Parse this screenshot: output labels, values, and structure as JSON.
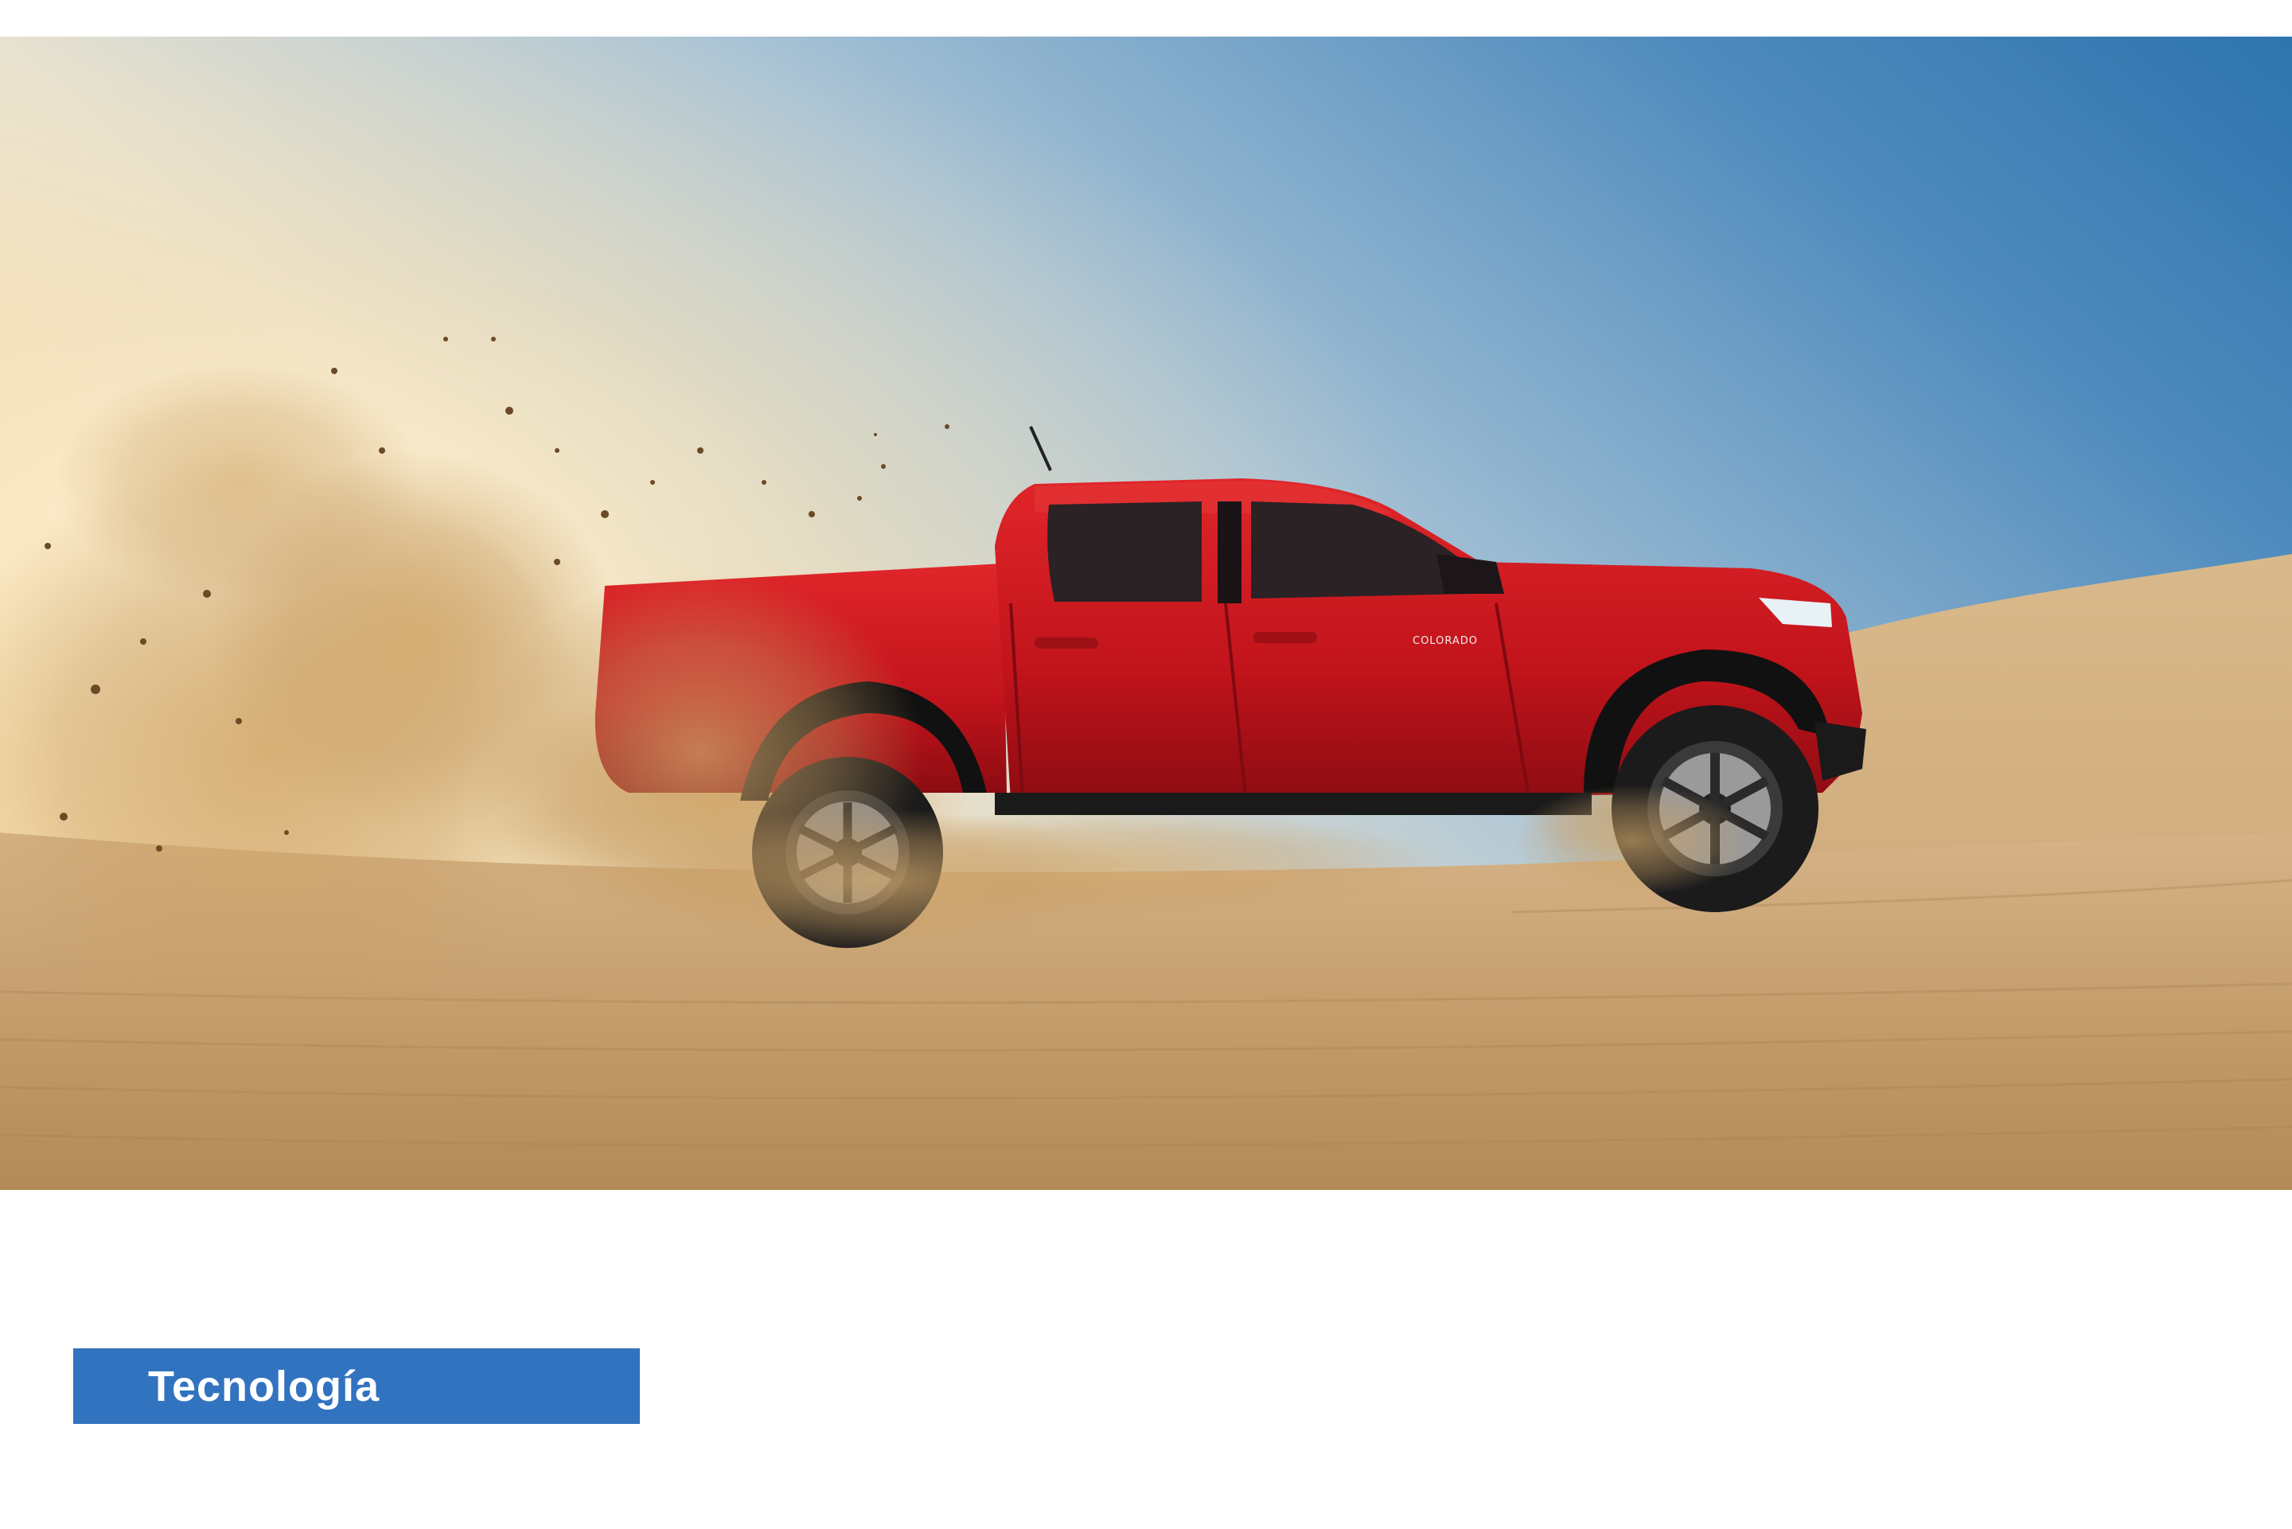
{
  "hero": {
    "image": "red pickup truck driving on sand dunes kicking up sand",
    "badge_text": "COLORADO"
  },
  "section_tag": {
    "label": "Tecnología"
  },
  "colors": {
    "tag_background": "#3273c0",
    "truck_red": "#c4141c",
    "sky_blue": "#3d7db5",
    "sand": "#c7a171"
  }
}
